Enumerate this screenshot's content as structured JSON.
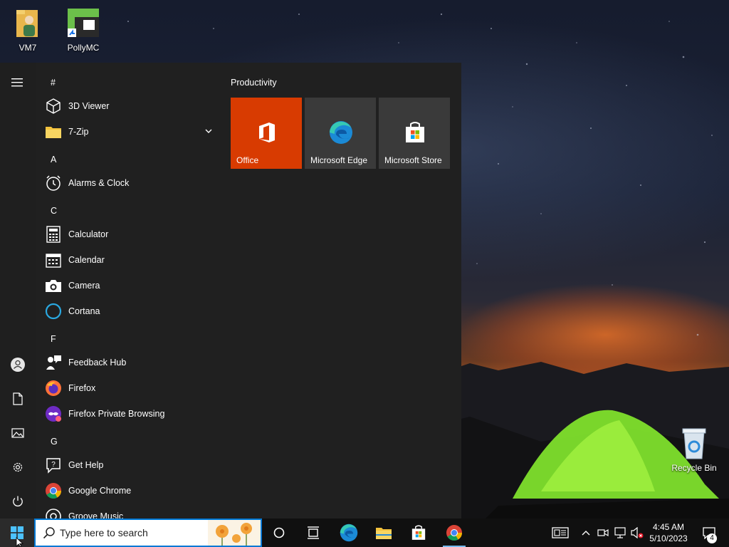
{
  "desktop": {
    "icons": [
      {
        "label": "VM7",
        "icon": "user-folder-icon"
      },
      {
        "label": "PollyMC",
        "icon": "pollymc-shortcut-icon"
      },
      {
        "label": "Recycle Bin",
        "icon": "recycle-bin-icon"
      }
    ]
  },
  "start_menu": {
    "rail": {
      "menu": "hamburger-icon",
      "account": "user-icon",
      "documents": "document-icon",
      "pictures": "picture-icon",
      "settings": "gear-icon",
      "power": "power-icon"
    },
    "app_list": {
      "sections": [
        {
          "header": "#",
          "apps": [
            {
              "label": "3D Viewer",
              "icon": "3d-viewer-icon"
            },
            {
              "label": "7-Zip",
              "icon": "folder-icon",
              "expandable": true
            }
          ]
        },
        {
          "header": "A",
          "apps": [
            {
              "label": "Alarms & Clock",
              "icon": "alarm-clock-icon"
            }
          ]
        },
        {
          "header": "C",
          "apps": [
            {
              "label": "Calculator",
              "icon": "calculator-icon"
            },
            {
              "label": "Calendar",
              "icon": "calendar-icon"
            },
            {
              "label": "Camera",
              "icon": "camera-icon"
            },
            {
              "label": "Cortana",
              "icon": "cortana-icon"
            }
          ]
        },
        {
          "header": "F",
          "apps": [
            {
              "label": "Feedback Hub",
              "icon": "feedback-hub-icon"
            },
            {
              "label": "Firefox",
              "icon": "firefox-icon"
            },
            {
              "label": "Firefox Private Browsing",
              "icon": "firefox-private-icon"
            }
          ]
        },
        {
          "header": "G",
          "apps": [
            {
              "label": "Get Help",
              "icon": "get-help-icon"
            },
            {
              "label": "Google Chrome",
              "icon": "chrome-icon"
            },
            {
              "label": "Groove Music",
              "icon": "groove-music-icon"
            }
          ]
        }
      ]
    },
    "tiles": {
      "group_title": "Productivity",
      "items": [
        {
          "label": "Office",
          "icon": "office-icon",
          "color": "#d83b01"
        },
        {
          "label": "Microsoft Edge",
          "icon": "edge-icon",
          "color": "#3a3a3a"
        },
        {
          "label": "Microsoft Store",
          "icon": "store-icon",
          "color": "#3a3a3a"
        }
      ]
    }
  },
  "taskbar": {
    "search": {
      "placeholder": "Type here to search"
    },
    "pinned": [
      {
        "name": "cortana-button",
        "icon": "circle-icon"
      },
      {
        "name": "task-view-button",
        "icon": "task-view-icon"
      },
      {
        "name": "edge-taskbar",
        "icon": "edge-icon"
      },
      {
        "name": "file-explorer-taskbar",
        "icon": "folder-icon"
      },
      {
        "name": "store-taskbar",
        "icon": "store-icon"
      },
      {
        "name": "chrome-taskbar",
        "icon": "chrome-icon",
        "active": true
      }
    ],
    "tray": {
      "time": "4:45 AM",
      "date": "5/10/2023",
      "notifications": "4"
    }
  },
  "colors": {
    "accent": "#0078d4",
    "start_bg": "#202020",
    "taskbar_bg": "#101010",
    "office_tile": "#d83b01"
  }
}
